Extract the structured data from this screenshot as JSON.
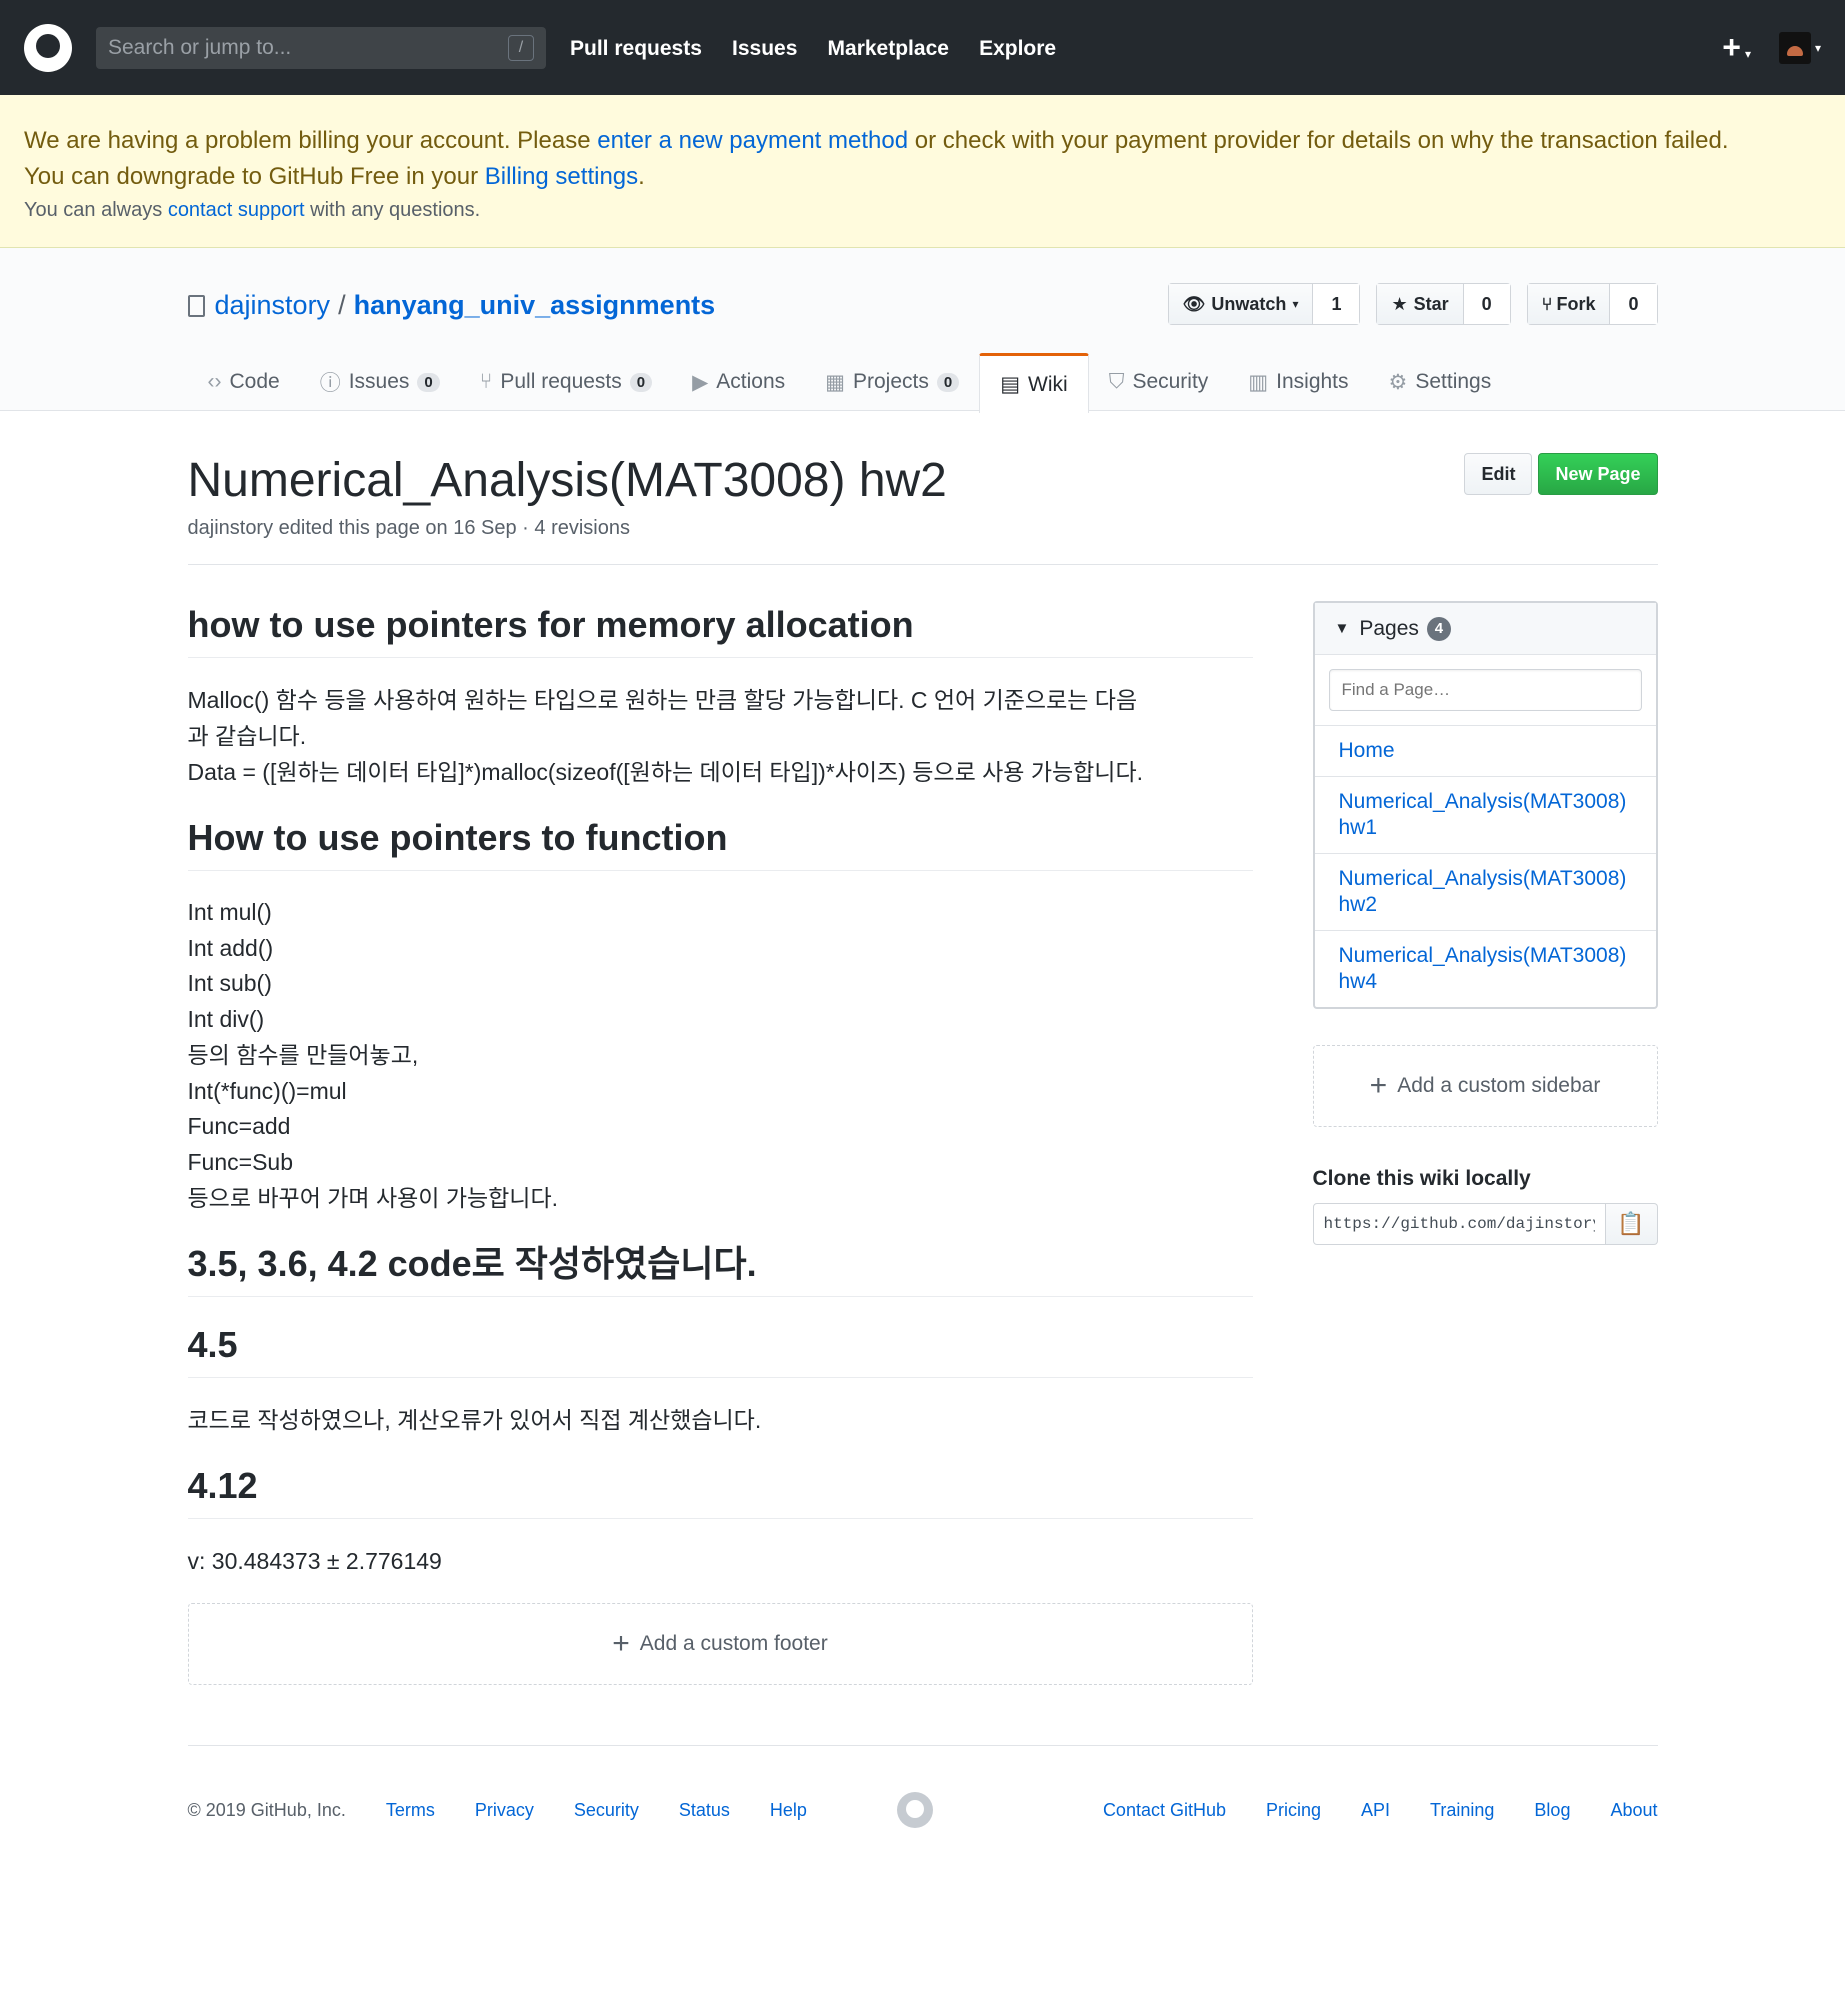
{
  "header": {
    "search_placeholder": "Search or jump to...",
    "slash": "/",
    "nav": [
      "Pull requests",
      "Issues",
      "Marketplace",
      "Explore"
    ],
    "plus": "+",
    "caret": "▾"
  },
  "banner": {
    "line1_a": "We are having a problem billing your account. Please ",
    "line1_link": "enter a new payment method",
    "line1_b": " or check with your payment provider for details on why the transaction failed.",
    "line2_a": "You can downgrade to GitHub Free in your ",
    "line2_link": "Billing settings",
    "line2_b": ".",
    "line3_a": "You can always ",
    "line3_link": "contact support",
    "line3_b": " with any questions."
  },
  "repo": {
    "owner": "dajinstory",
    "sep": "/",
    "name": "hanyang_univ_assignments",
    "unwatch_label": "Unwatch",
    "watch_count": "1",
    "star_label": "Star",
    "star_count": "0",
    "fork_label": "Fork",
    "fork_count": "0"
  },
  "tabs": [
    {
      "label": "Code",
      "icon": "‹›"
    },
    {
      "label": "Issues",
      "icon": "ⓘ",
      "count": "0"
    },
    {
      "label": "Pull requests",
      "icon": "⑂",
      "count": "0"
    },
    {
      "label": "Actions",
      "icon": "▶"
    },
    {
      "label": "Projects",
      "icon": "▦",
      "count": "0"
    },
    {
      "label": "Wiki",
      "icon": "▤"
    },
    {
      "label": "Security",
      "icon": "⛉"
    },
    {
      "label": "Insights",
      "icon": "▥"
    },
    {
      "label": "Settings",
      "icon": "⚙"
    }
  ],
  "page": {
    "title": "Numerical_Analysis(MAT3008) hw2",
    "meta": "dajinstory edited this page on 16 Sep · 4 revisions",
    "edit_label": "Edit",
    "new_page_label": "New Page"
  },
  "content": {
    "h1": "how to use pointers for memory allocation",
    "p1_l1": "Malloc() 함수 등을 사용하여 원하는 타입으로 원하는 만큼 할당 가능합니다. C 언어 기준으로는 다음",
    "p1_l2": "과 같습니다.",
    "p1_l3": "Data = ([원하는 데이터 타입]*)malloc(sizeof([원하는 데이터 타입])*사이즈) 등으로 사용 가능합니다.",
    "h2": "How to use pointers to function",
    "lines": [
      "Int mul()",
      "Int add()",
      "Int sub()",
      "Int div()",
      "등의 함수를 만들어놓고,",
      "Int(*func)()=mul",
      "Func=add",
      "Func=Sub",
      "등으로 바꾸어 가며 사용이 가능합니다."
    ],
    "h3": "3.5, 3.6, 4.2 code로 작성하였습니다.",
    "h4": "4.5",
    "p4": "코드로 작성하였으나, 계산오류가 있어서 직접 계산했습니다.",
    "h5": "4.12",
    "p5": "v: 30.484373 ± 2.776149",
    "footer_add": "Add a custom footer"
  },
  "sidebar": {
    "pages_label": "Pages",
    "pages_count": "4",
    "find_placeholder": "Find a Page…",
    "pages": [
      {
        "l1": "Home"
      },
      {
        "l1": "Numerical_Analysis(MAT3008)",
        "l2": "hw1"
      },
      {
        "l1": "Numerical_Analysis(MAT3008)",
        "l2": "hw2"
      },
      {
        "l1": "Numerical_Analysis(MAT3008)",
        "l2": "hw4"
      }
    ],
    "add_sidebar": "Add a custom sidebar",
    "clone_title": "Clone this wiki locally",
    "clone_url": "https://github.com/dajinstory/hanyang_univ_assignments.wiki.git"
  },
  "footer": {
    "copyright": "© 2019 GitHub, Inc.",
    "left_links": [
      "Terms",
      "Privacy",
      "Security",
      "Status",
      "Help"
    ],
    "right_links": [
      "Contact GitHub",
      "Pricing",
      "API",
      "Training",
      "Blog",
      "About"
    ]
  },
  "colors": {
    "header_bg": "#24292e",
    "banner_bg": "#fffbdd",
    "link": "#0366d6",
    "primary_button": "#28a745",
    "active_tab_accent": "#e36209"
  }
}
